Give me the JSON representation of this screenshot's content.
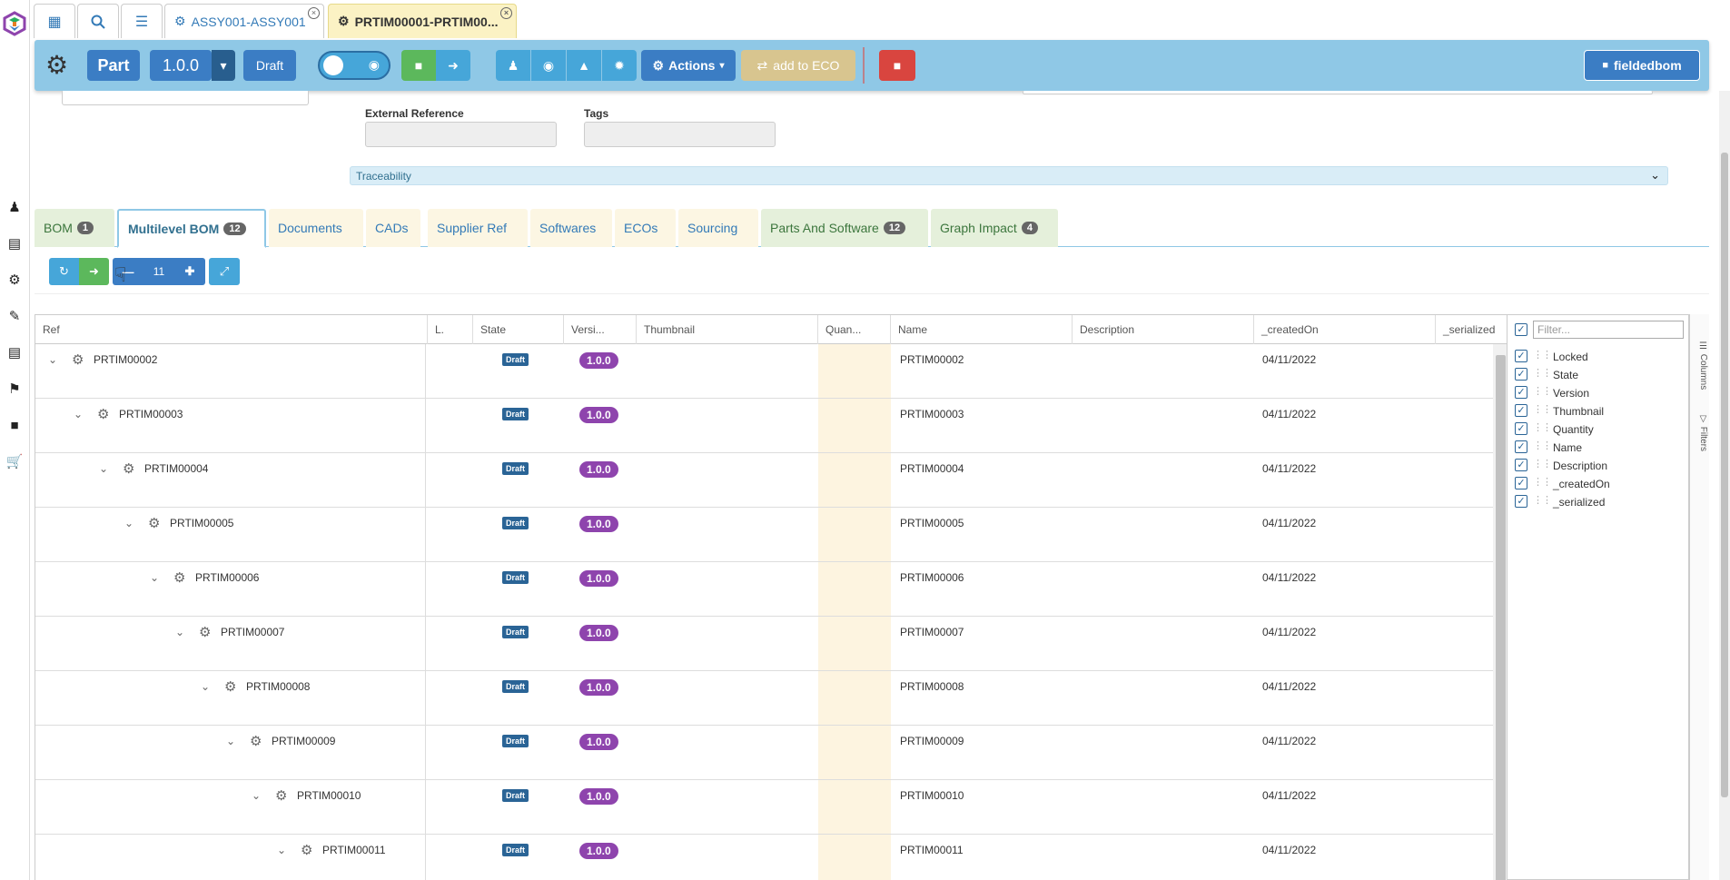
{
  "top_tabs": [
    {
      "label": "ASSY001-ASSY001"
    },
    {
      "label": "PRTIM00001-PRTIM00..."
    }
  ],
  "toolbar": {
    "type_label": "Part",
    "version_label": "1.0.0",
    "state_label": "Draft",
    "actions_label": "Actions",
    "add_eco_label": "add to ECO",
    "fieldedbom_label": "fieldedbom"
  },
  "form": {
    "external_reference_label": "External Reference",
    "external_reference_value": "",
    "tags_label": "Tags",
    "tags_value": "",
    "traceability_label": "Traceability"
  },
  "content_tabs": [
    {
      "label": "BOM",
      "badge": "1"
    },
    {
      "label": "Multilevel BOM",
      "badge": "12"
    },
    {
      "label": "Documents"
    },
    {
      "label": "CADs"
    },
    {
      "label": "Supplier Ref"
    },
    {
      "label": "Softwares"
    },
    {
      "label": "ECOs"
    },
    {
      "label": "Sourcing"
    },
    {
      "label": "Parts And Software",
      "badge": "12"
    },
    {
      "label": "Graph Impact",
      "badge": "4"
    }
  ],
  "level_value": "11",
  "grid": {
    "columns": [
      "Ref",
      "L.",
      "State",
      "Versi...",
      "Thumbnail",
      "Quan...",
      "Name",
      "Description",
      "_createdOn",
      "_serialized"
    ],
    "rows": [
      {
        "ref": "PRTIM00002",
        "state": "Draft",
        "version": "1.0.0",
        "name": "PRTIM00002",
        "created": "04/11/2022"
      },
      {
        "ref": "PRTIM00003",
        "state": "Draft",
        "version": "1.0.0",
        "name": "PRTIM00003",
        "created": "04/11/2022"
      },
      {
        "ref": "PRTIM00004",
        "state": "Draft",
        "version": "1.0.0",
        "name": "PRTIM00004",
        "created": "04/11/2022"
      },
      {
        "ref": "PRTIM00005",
        "state": "Draft",
        "version": "1.0.0",
        "name": "PRTIM00005",
        "created": "04/11/2022"
      },
      {
        "ref": "PRTIM00006",
        "state": "Draft",
        "version": "1.0.0",
        "name": "PRTIM00006",
        "created": "04/11/2022"
      },
      {
        "ref": "PRTIM00007",
        "state": "Draft",
        "version": "1.0.0",
        "name": "PRTIM00007",
        "created": "04/11/2022"
      },
      {
        "ref": "PRTIM00008",
        "state": "Draft",
        "version": "1.0.0",
        "name": "PRTIM00008",
        "created": "04/11/2022"
      },
      {
        "ref": "PRTIM00009",
        "state": "Draft",
        "version": "1.0.0",
        "name": "PRTIM00009",
        "created": "04/11/2022"
      },
      {
        "ref": "PRTIM00010",
        "state": "Draft",
        "version": "1.0.0",
        "name": "PRTIM00010",
        "created": "04/11/2022"
      },
      {
        "ref": "PRTIM00011",
        "state": "Draft",
        "version": "1.0.0",
        "name": "PRTIM00011",
        "created": "04/11/2022"
      }
    ]
  },
  "column_panel": {
    "filter_placeholder": "Filter...",
    "items": [
      "Locked",
      "State",
      "Version",
      "Thumbnail",
      "Quantity",
      "Name",
      "Description",
      "_createdOn",
      "_serialized"
    ],
    "side_tabs": [
      "Columns",
      "Filters"
    ]
  },
  "colors": {
    "toolbar_bg": "#8fc8e6",
    "state_badge": "#2a6496",
    "version_badge": "#8e44ad",
    "quantity_column": "#fdf4e0"
  }
}
